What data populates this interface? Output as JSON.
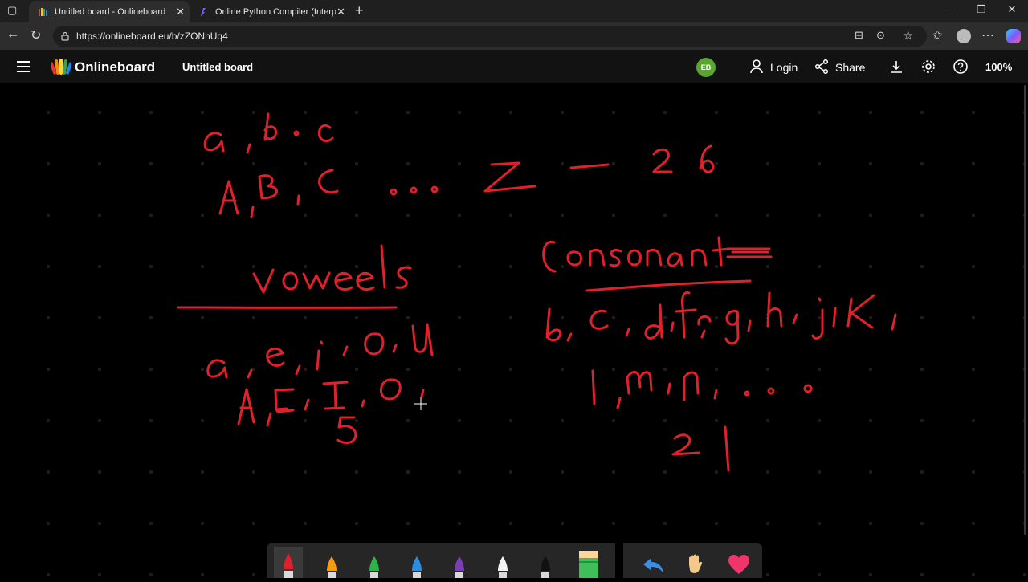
{
  "browser": {
    "tabs": [
      {
        "title": "Untitled board - Onlineboard",
        "active": true
      },
      {
        "title": "Online Python Compiler (Interpre",
        "active": false
      }
    ],
    "url": "https://onlineboard.eu/b/zZONhUq4"
  },
  "app": {
    "brand": "Onlineboard",
    "board_title": "Untitled board",
    "avatar_initials": "EB",
    "login_label": "Login",
    "share_label": "Share",
    "zoom": "100%"
  },
  "toolbar": {
    "pens": [
      "red",
      "orange",
      "green",
      "blue",
      "purple",
      "white",
      "black"
    ],
    "colors": {
      "red": "#e0202a",
      "orange": "#f59a13",
      "green": "#2fb14a",
      "blue": "#2b8de0",
      "purple": "#7b3fb5",
      "white": "#f4f4f4",
      "black": "#111111"
    },
    "tools": [
      "marker-highlighter",
      "undo",
      "hand-pan",
      "heart"
    ]
  },
  "ink_color": "#e0202a"
}
